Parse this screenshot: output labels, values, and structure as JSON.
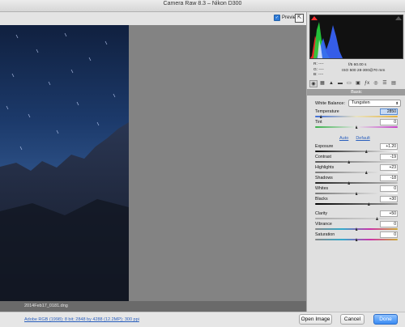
{
  "window": {
    "title": "Camera Raw 8.3  –  Nikon D300"
  },
  "toolbar": {
    "preview_label": "Preview",
    "preview_checked": "✓",
    "fullscreen_glyph": "⇱"
  },
  "image": {
    "filename": "2014Feb17_0181.dng"
  },
  "histogram": {
    "colors": {
      "red": "#ff2a2a",
      "green": "#27d33e",
      "blue": "#3a66ff",
      "overlap": "#ffffff"
    }
  },
  "camera_info": {
    "r": "R:",
    "r_val": "----",
    "g": "G:",
    "g_val": "----",
    "b": "B:",
    "b_val": "----",
    "aperture_shutter": "f/5   60.00 s",
    "iso_lens": "ISO 500   28-300@70 mm"
  },
  "panel": {
    "section_title": "Basic",
    "white_balance_label": "White Balance:",
    "white_balance_value": "Tungsten",
    "auto_label": "Auto",
    "default_label": "Default",
    "sliders": [
      {
        "label": "Temperature",
        "value": "2850",
        "level": 0.07
      },
      {
        "label": "Tint",
        "value": "0",
        "level": 0.5
      },
      {
        "label": "Exposure",
        "value": "+1.20",
        "level": 0.62
      },
      {
        "label": "Contrast",
        "value": "-19",
        "level": 0.41
      },
      {
        "label": "Highlights",
        "value": "+23",
        "level": 0.62
      },
      {
        "label": "Shadows",
        "value": "-18",
        "level": 0.41
      },
      {
        "label": "Whites",
        "value": "0",
        "level": 0.5
      },
      {
        "label": "Blacks",
        "value": "+30",
        "level": 0.65
      },
      {
        "label": "Clarity",
        "value": "+50",
        "level": 0.75
      },
      {
        "label": "Vibrance",
        "value": "0",
        "level": 0.5
      },
      {
        "label": "Saturation",
        "value": "0",
        "level": 0.5
      }
    ]
  },
  "footer": {
    "workflow_link": "Adobe RGB (1998); 8 bit; 2848 by 4288 (12.2MP); 300 ppi",
    "open_image": "Open Image",
    "cancel": "Cancel",
    "done": "Done"
  },
  "colors": {
    "accent": "#3a8cf3",
    "link": "#2a5fbd"
  }
}
